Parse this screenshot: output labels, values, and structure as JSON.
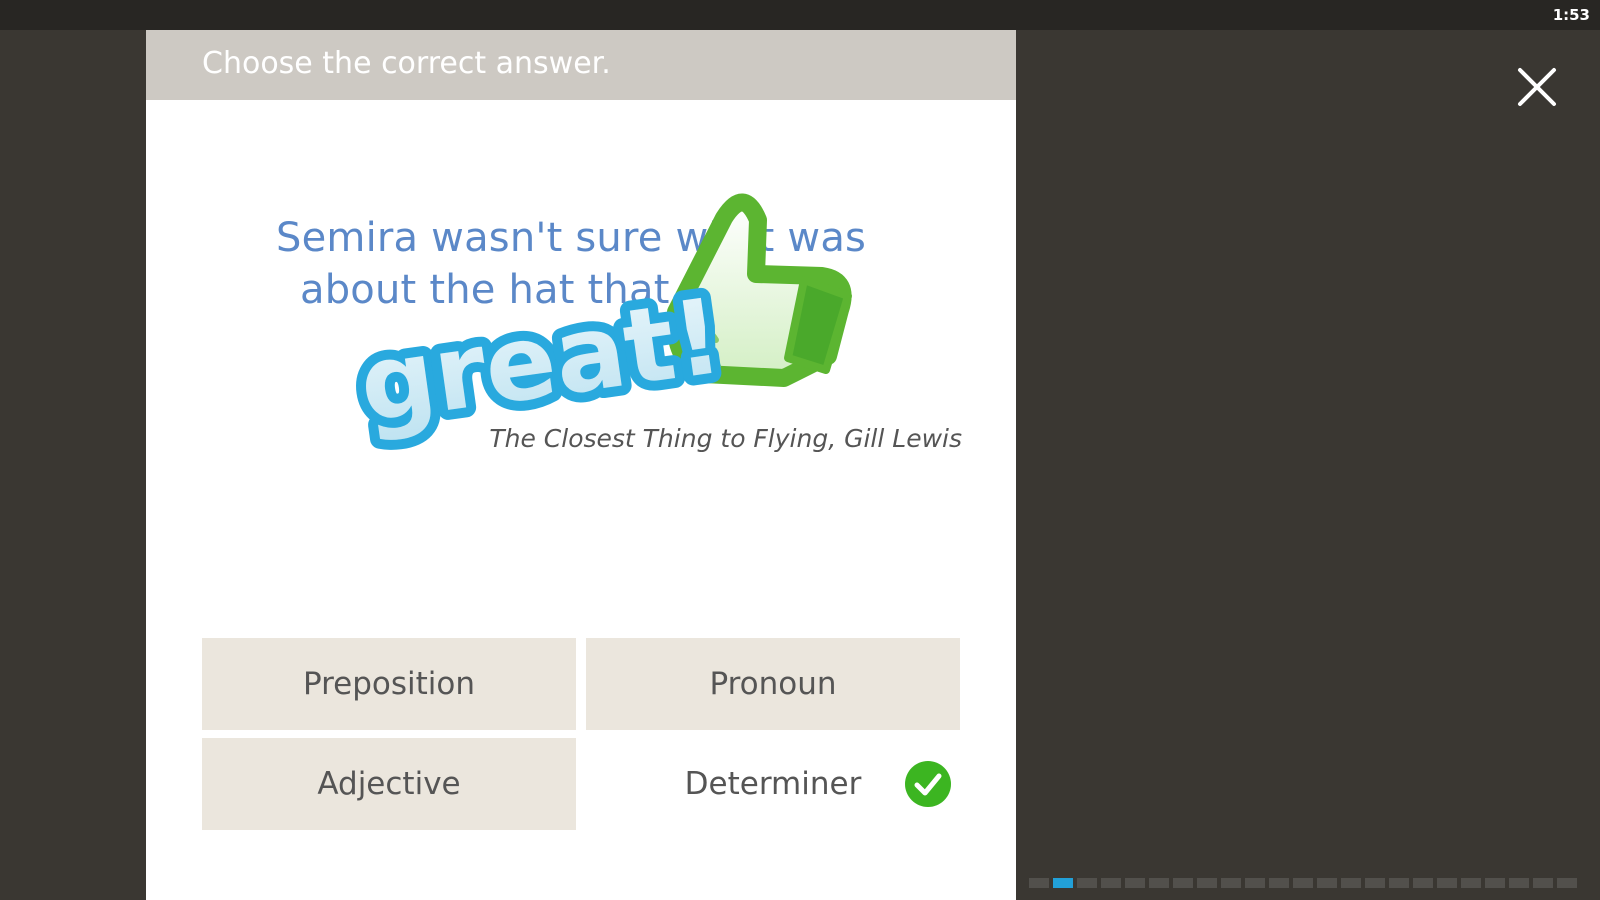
{
  "status_bar": {
    "time": "1:53"
  },
  "card": {
    "instruction": "Choose the correct answer.",
    "question_line1": "Semira wasn't sure what was",
    "question_line2": "about the hat that she...",
    "citation": "The Closest Thing to Flying, Gill Lewis"
  },
  "feedback": {
    "word": "great!",
    "icon": "thumbs-up-icon"
  },
  "answers": [
    {
      "label": "Preposition",
      "correct": false
    },
    {
      "label": "Pronoun",
      "correct": false
    },
    {
      "label": "Adjective",
      "correct": false
    },
    {
      "label": "Determiner",
      "correct": true
    }
  ],
  "progress": {
    "total": 23,
    "current": 2
  },
  "colors": {
    "background": "#3a3732",
    "header": "#cdc9c3",
    "question_text": "#5b88c8",
    "answer_bg": "#ebe6dd",
    "correct": "#3cb521",
    "progress_active": "#22a0d8"
  }
}
